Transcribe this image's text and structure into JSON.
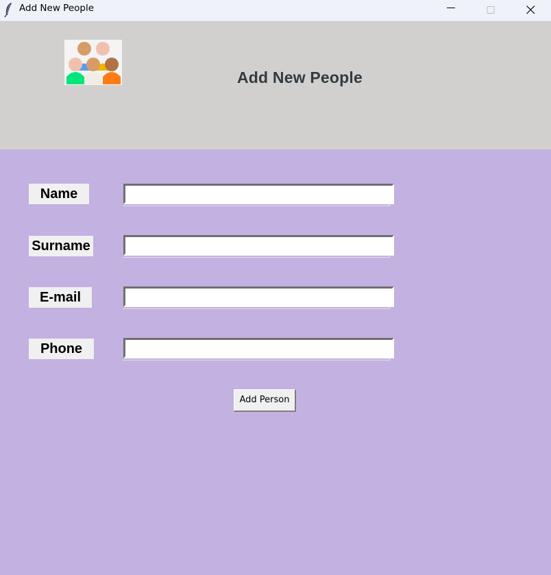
{
  "window": {
    "title": "Add New People",
    "icon": "feather-icon"
  },
  "header": {
    "logo": "people-group-icon",
    "title": "Add New People",
    "background": "#d1d0ce"
  },
  "form": {
    "background": "#c3b1e1",
    "fields": [
      {
        "label": "Name",
        "value": ""
      },
      {
        "label": "Surname",
        "value": ""
      },
      {
        "label": "E-mail",
        "value": ""
      },
      {
        "label": "Phone",
        "value": ""
      }
    ],
    "submit_label": "Add Person"
  }
}
